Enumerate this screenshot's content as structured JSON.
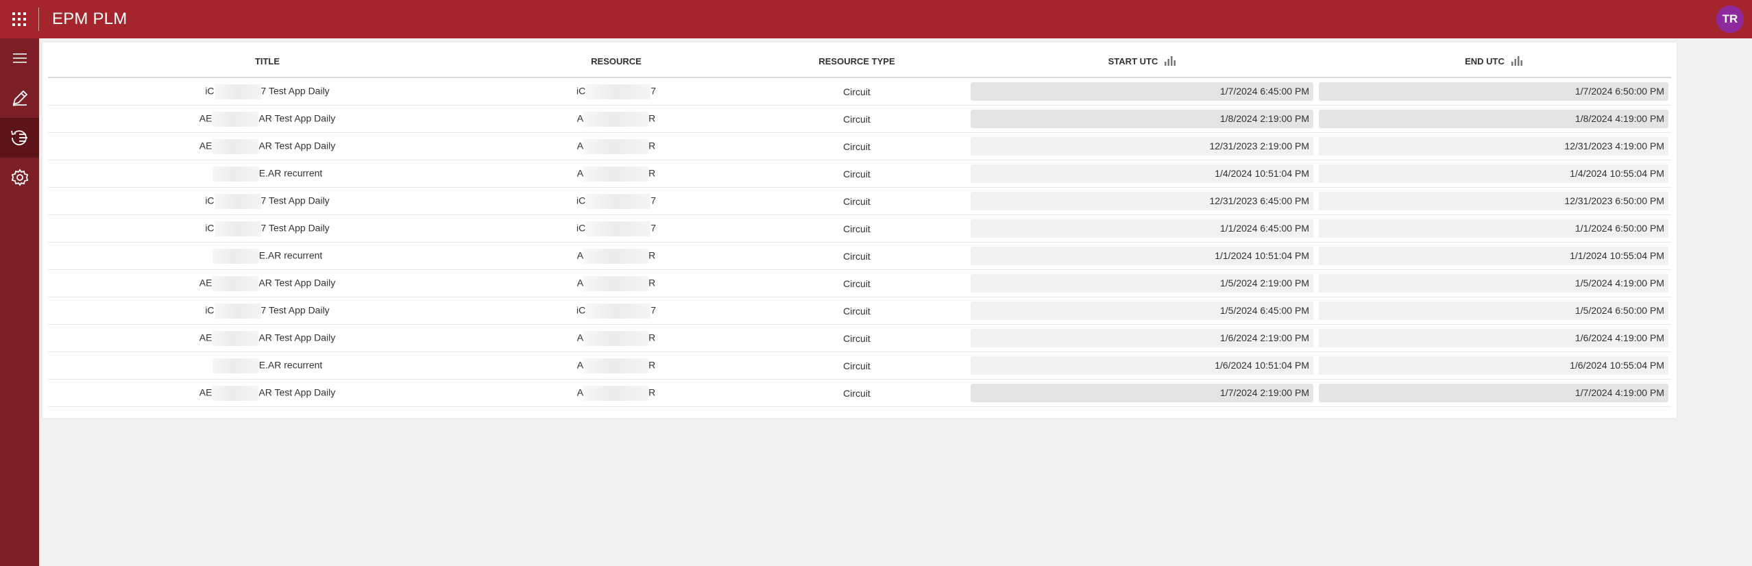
{
  "header": {
    "app_title": "EPM PLM",
    "avatar_initials": "TR"
  },
  "sidebar": {
    "items": [
      {
        "icon": "hamburger-icon",
        "active": false
      },
      {
        "icon": "edit-icon",
        "active": false
      },
      {
        "icon": "history-icon",
        "active": true
      },
      {
        "icon": "gear-icon",
        "active": false
      }
    ]
  },
  "table": {
    "columns": {
      "title": "TITLE",
      "resource": "RESOURCE",
      "resource_type": "RESOURCE TYPE",
      "start_utc": "START UTC",
      "end_utc": "END UTC"
    },
    "rows": [
      {
        "title_prefix": "iC",
        "title_suffix": "7 Test App Daily",
        "resource_prefix": "iC",
        "resource_suffix": "7",
        "type": "Circuit",
        "start": "1/7/2024 6:45:00 PM",
        "end": "1/7/2024 6:50:00 PM",
        "shade": "dark"
      },
      {
        "title_prefix": "AE",
        "title_suffix": "AR Test App Daily",
        "resource_prefix": "A",
        "resource_suffix": "R",
        "type": "Circuit",
        "start": "1/8/2024 2:19:00 PM",
        "end": "1/8/2024 4:19:00 PM",
        "shade": "dark"
      },
      {
        "title_prefix": "AE",
        "title_suffix": "AR Test App Daily",
        "resource_prefix": "A",
        "resource_suffix": "R",
        "type": "Circuit",
        "start": "12/31/2023 2:19:00 PM",
        "end": "12/31/2023 4:19:00 PM",
        "shade": "light"
      },
      {
        "title_prefix": "",
        "title_suffix": "E.AR recurrent",
        "resource_prefix": "A",
        "resource_suffix": "R",
        "type": "Circuit",
        "start": "1/4/2024 10:51:04 PM",
        "end": "1/4/2024 10:55:04 PM",
        "shade": "light"
      },
      {
        "title_prefix": "iC",
        "title_suffix": "7 Test App Daily",
        "resource_prefix": "iC",
        "resource_suffix": "7",
        "type": "Circuit",
        "start": "12/31/2023 6:45:00 PM",
        "end": "12/31/2023 6:50:00 PM",
        "shade": "light"
      },
      {
        "title_prefix": "iC",
        "title_suffix": "7 Test App Daily",
        "resource_prefix": "iC",
        "resource_suffix": "7",
        "type": "Circuit",
        "start": "1/1/2024 6:45:00 PM",
        "end": "1/1/2024 6:50:00 PM",
        "shade": "light"
      },
      {
        "title_prefix": "",
        "title_suffix": "E.AR recurrent",
        "resource_prefix": "A",
        "resource_suffix": "R",
        "type": "Circuit",
        "start": "1/1/2024 10:51:04 PM",
        "end": "1/1/2024 10:55:04 PM",
        "shade": "light"
      },
      {
        "title_prefix": "AE",
        "title_suffix": "AR Test App Daily",
        "resource_prefix": "A",
        "resource_suffix": "R",
        "type": "Circuit",
        "start": "1/5/2024 2:19:00 PM",
        "end": "1/5/2024 4:19:00 PM",
        "shade": "light"
      },
      {
        "title_prefix": "iC",
        "title_suffix": "7 Test App Daily",
        "resource_prefix": "iC",
        "resource_suffix": "7",
        "type": "Circuit",
        "start": "1/5/2024 6:45:00 PM",
        "end": "1/5/2024 6:50:00 PM",
        "shade": "light"
      },
      {
        "title_prefix": "AE",
        "title_suffix": "AR Test App Daily",
        "resource_prefix": "A",
        "resource_suffix": "R",
        "type": "Circuit",
        "start": "1/6/2024 2:19:00 PM",
        "end": "1/6/2024 4:19:00 PM",
        "shade": "light"
      },
      {
        "title_prefix": "",
        "title_suffix": "E.AR recurrent",
        "resource_prefix": "A",
        "resource_suffix": "R",
        "type": "Circuit",
        "start": "1/6/2024 10:51:04 PM",
        "end": "1/6/2024 10:55:04 PM",
        "shade": "light"
      },
      {
        "title_prefix": "AE",
        "title_suffix": "AR Test App Daily",
        "resource_prefix": "A",
        "resource_suffix": "R",
        "type": "Circuit",
        "start": "1/7/2024 2:19:00 PM",
        "end": "1/7/2024 4:19:00 PM",
        "shade": "dark"
      }
    ]
  }
}
